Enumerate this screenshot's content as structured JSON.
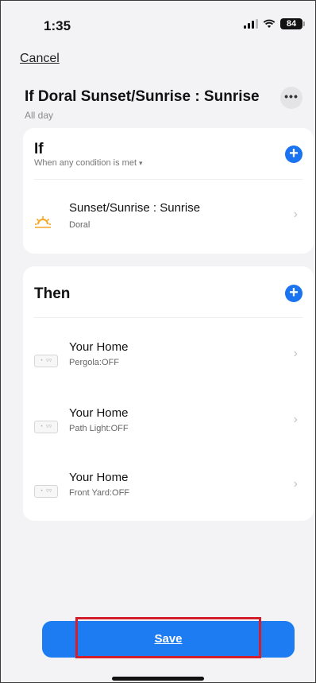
{
  "status_bar": {
    "time": "1:35",
    "battery": "84"
  },
  "nav": {
    "cancel_label": "Cancel"
  },
  "header": {
    "title": "If Doral Sunset/Sunrise : Sunrise",
    "subtitle": "All day",
    "more_label": "•••"
  },
  "if_section": {
    "title": "If",
    "mode": "When any condition is met",
    "add_label": "+",
    "conditions": [
      {
        "title": "Sunset/Sunrise : Sunrise",
        "subtitle": "Doral",
        "icon": "sunrise-icon"
      }
    ]
  },
  "then_section": {
    "title": "Then",
    "add_label": "+",
    "actions": [
      {
        "title": "Your Home",
        "subtitle": "Pergola:OFF",
        "icon": "switch-icon"
      },
      {
        "title": "Your Home",
        "subtitle": "Path Light:OFF",
        "icon": "switch-icon"
      },
      {
        "title": "Your Home",
        "subtitle": "Front Yard:OFF",
        "icon": "switch-icon"
      }
    ]
  },
  "footer": {
    "save_label": "Save"
  },
  "colors": {
    "accent": "#1d7cf2",
    "highlight": "#d21f2b",
    "sun": "#f5a623"
  }
}
